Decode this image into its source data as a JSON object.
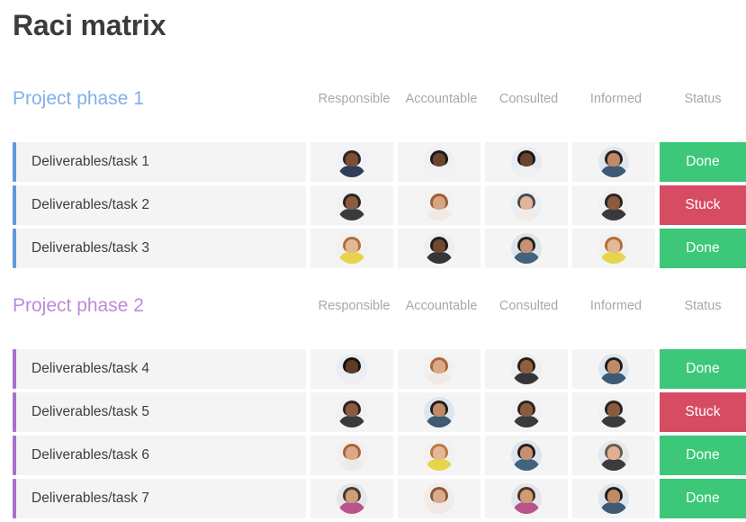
{
  "page": {
    "title": "Raci matrix",
    "background": "#ffffff"
  },
  "colors": {
    "phase1_accent": "#6398da",
    "phase1_title": "#7fb0e8",
    "phase2_accent": "#a96fce",
    "phase2_title": "#bd8ada",
    "status_done": "#3cc878",
    "status_stuck": "#d74b63",
    "row_background": "#f4f4f4",
    "header_text": "#a8a8a8",
    "title_text": "#3c3c3c"
  },
  "columns": {
    "task": "",
    "avatar_headers": [
      "Responsible",
      "Accountable",
      "Consulted",
      "Informed"
    ],
    "status": "Status"
  },
  "phases": [
    {
      "title": "Project phase 1",
      "headers": [
        "Responsible",
        "Accountable",
        "Consulted",
        "Informed",
        "Status"
      ],
      "rows": [
        {
          "task": "Deliverables/task 1",
          "status": "Done",
          "status_kind": "done",
          "avatars": [
            {
              "name": "avatar-responsible",
              "bg": "#f1f2f6",
              "hair": "#2c2420",
              "face": "#7a4f35",
              "body": "#2e3f57"
            },
            {
              "name": "avatar-accountable",
              "bg": "#eef0f5",
              "hair": "#1d1815",
              "face": "#6b4430",
              "body": "#f2f3f5"
            },
            {
              "name": "avatar-consulted",
              "bg": "#e7eaf0",
              "hair": "#1a1512",
              "face": "#6a4330",
              "body": "#eef0f3"
            },
            {
              "name": "avatar-informed",
              "bg": "#dfe6ee",
              "hair": "#2a211c",
              "face": "#c08a69",
              "body": "#3f5a72"
            }
          ]
        },
        {
          "task": "Deliverables/task 2",
          "status": "Stuck",
          "status_kind": "stuck",
          "avatars": [
            {
              "name": "avatar-responsible",
              "bg": "#f2f2f2",
              "hair": "#2b2420",
              "face": "#8a5c3e",
              "body": "#3a3a3c"
            },
            {
              "name": "avatar-accountable",
              "bg": "#f3f2f0",
              "hair": "#9c5f35",
              "face": "#d6a383",
              "body": "#efeae6"
            },
            {
              "name": "avatar-consulted",
              "bg": "#eceff3",
              "hair": "#4a4a4c",
              "face": "#e0b59a",
              "body": "#f0ece8"
            },
            {
              "name": "avatar-informed",
              "bg": "#f1f1f1",
              "hair": "#2a2320",
              "face": "#8a5c3e",
              "body": "#3a3a3c"
            }
          ]
        },
        {
          "task": "Deliverables/task 3",
          "status": "Done",
          "status_kind": "done",
          "avatars": [
            {
              "name": "avatar-responsible",
              "bg": "#f3f1ee",
              "hair": "#b06f3c",
              "face": "#e4b896",
              "body": "#e8d44a"
            },
            {
              "name": "avatar-accountable",
              "bg": "#efefef",
              "hair": "#221c18",
              "face": "#6f4830",
              "body": "#35353a"
            },
            {
              "name": "avatar-consulted",
              "bg": "#dde5ec",
              "hair": "#251d19",
              "face": "#c59172",
              "body": "#41637f"
            },
            {
              "name": "avatar-informed",
              "bg": "#f3f1ee",
              "hair": "#b06f3c",
              "face": "#e4b896",
              "body": "#e8d44a"
            }
          ]
        }
      ]
    },
    {
      "title": "Project phase 2",
      "headers": [
        "Responsible",
        "Accountable",
        "Consulted",
        "Informed",
        "Status"
      ],
      "rows": [
        {
          "task": "Deliverables/task 4",
          "status": "Done",
          "status_kind": "done",
          "avatars": [
            {
              "name": "avatar-responsible",
              "bg": "#e9ecf4",
              "hair": "#16120f",
              "face": "#5f3b29",
              "body": "#eceef2"
            },
            {
              "name": "avatar-accountable",
              "bg": "#f2f1ef",
              "hair": "#a9663a",
              "face": "#dba987",
              "body": "#efeae6"
            },
            {
              "name": "avatar-consulted",
              "bg": "#eeeeee",
              "hair": "#272019",
              "face": "#8d6040",
              "body": "#34343a"
            },
            {
              "name": "avatar-informed",
              "bg": "#dde6ef",
              "hair": "#241c18",
              "face": "#c08a69",
              "body": "#3f5a72"
            }
          ]
        },
        {
          "task": "Deliverables/task 5",
          "status": "Stuck",
          "status_kind": "stuck",
          "avatars": [
            {
              "name": "avatar-responsible",
              "bg": "#f1f1f1",
              "hair": "#2a2320",
              "face": "#8a5c3e",
              "body": "#3a3a3c"
            },
            {
              "name": "avatar-accountable",
              "bg": "#dde6ef",
              "hair": "#241c18",
              "face": "#c08a69",
              "body": "#3f5a72"
            },
            {
              "name": "avatar-consulted",
              "bg": "#f1f1f1",
              "hair": "#2a2320",
              "face": "#8a5c3e",
              "body": "#3a3a3c"
            },
            {
              "name": "avatar-informed",
              "bg": "#f1f1f1",
              "hair": "#2a2320",
              "face": "#8a5c3e",
              "body": "#3a3a3c"
            }
          ]
        },
        {
          "task": "Deliverables/task 6",
          "status": "Done",
          "status_kind": "done",
          "avatars": [
            {
              "name": "avatar-responsible",
              "bg": "#f2f1ef",
              "hair": "#a9663a",
              "face": "#dba987",
              "body": "#efeae6"
            },
            {
              "name": "avatar-accountable",
              "bg": "#f3f1ee",
              "hair": "#b97a43",
              "face": "#e4b896",
              "body": "#e8d44a"
            },
            {
              "name": "avatar-consulted",
              "bg": "#dde5ec",
              "hair": "#251d19",
              "face": "#c59172",
              "body": "#41637f"
            },
            {
              "name": "avatar-informed",
              "bg": "#e6e8ec",
              "hair": "#6b5a4c",
              "face": "#e0b093",
              "body": "#3a3a3f"
            }
          ]
        },
        {
          "task": "Deliverables/task 7",
          "status": "Done",
          "status_kind": "done",
          "avatars": [
            {
              "name": "avatar-responsible",
              "bg": "#e5e6ea",
              "hair": "#4a3528",
              "face": "#cf9d78",
              "body": "#b9548c"
            },
            {
              "name": "avatar-accountable",
              "bg": "#f0eeec",
              "hair": "#8d5a32",
              "face": "#d9ab8a",
              "body": "#efeae6"
            },
            {
              "name": "avatar-consulted",
              "bg": "#e5e6ea",
              "hair": "#4a3528",
              "face": "#cf9d78",
              "body": "#b9548c"
            },
            {
              "name": "avatar-informed",
              "bg": "#dde6ef",
              "hair": "#241c18",
              "face": "#c08a69",
              "body": "#3f5a72"
            }
          ]
        }
      ]
    }
  ]
}
